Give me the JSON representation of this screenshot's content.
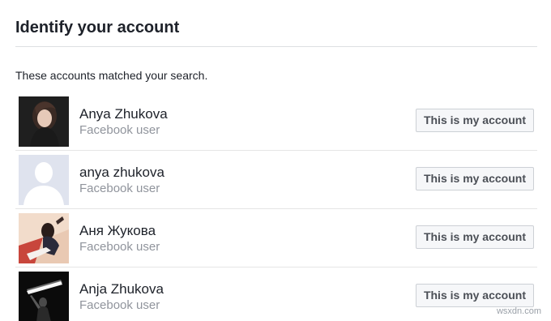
{
  "header": {
    "title": "Identify your account"
  },
  "intro": "These accounts matched your search.",
  "accounts": [
    {
      "name": "Anya Zhukova",
      "subtitle": "Facebook user",
      "button_label": "This is my account",
      "avatar": "profile-photo"
    },
    {
      "name": "anya zhukova",
      "subtitle": "Facebook user",
      "button_label": "This is my account",
      "avatar": "default-silhouette"
    },
    {
      "name": "Аня Жукова",
      "subtitle": "Facebook user",
      "button_label": "This is my account",
      "avatar": "profile-photo"
    },
    {
      "name": "Anja Zhukova",
      "subtitle": "Facebook user",
      "button_label": "This is my account",
      "avatar": "profile-photo"
    }
  ],
  "watermark": "wsxdn.com",
  "colors": {
    "text": "#1d2129",
    "muted": "#90949c",
    "button_bg": "#f6f7f9",
    "button_border": "#ccd0d5",
    "divider": "#dddfe2"
  }
}
